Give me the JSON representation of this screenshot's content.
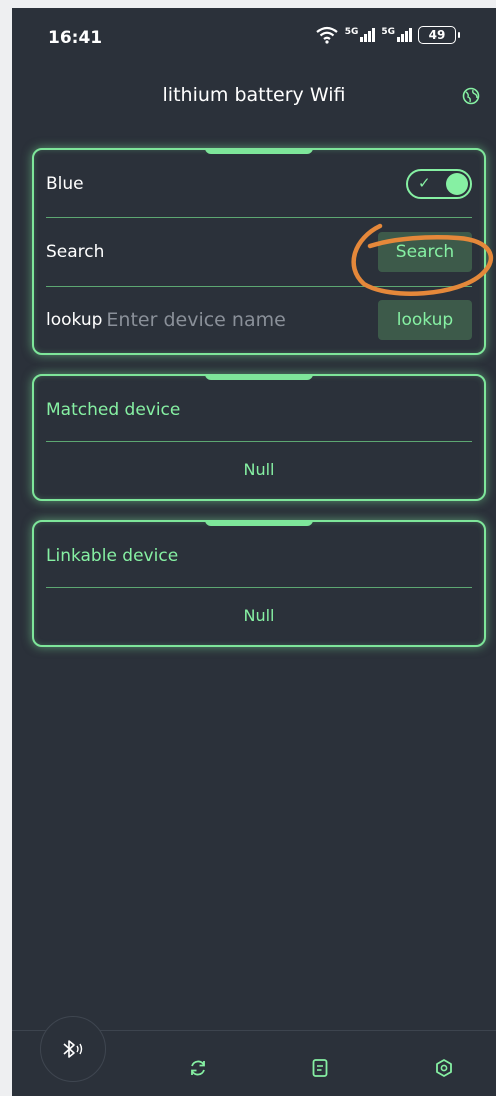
{
  "status_bar": {
    "time": "16:41",
    "network_1": "5G",
    "network_2": "5G",
    "battery": "49"
  },
  "header": {
    "title": "lithium battery Wifi",
    "globe_icon": "globe-icon"
  },
  "bluetooth_card": {
    "blue_label": "Blue",
    "blue_enabled": true,
    "search_label": "Search",
    "search_button": "Search",
    "lookup_label": "lookup",
    "lookup_placeholder": "Enter device name",
    "lookup_value": "",
    "lookup_button": "lookup"
  },
  "matched_card": {
    "title": "Matched device",
    "empty_text": "Null"
  },
  "linkable_card": {
    "title": "Linkable device",
    "empty_text": "Null"
  },
  "bottom_nav": {
    "items": [
      "bluetooth-icon",
      "refresh-icon",
      "document-icon",
      "settings-icon"
    ]
  },
  "colors": {
    "accent": "#86f0a3",
    "background": "#2b313a",
    "annotation": "#e5883a"
  }
}
